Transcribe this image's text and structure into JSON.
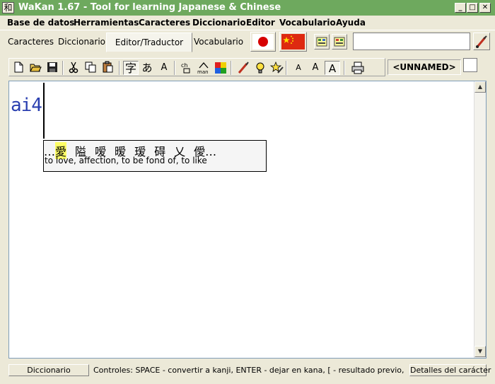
{
  "window": {
    "app_icon_glyph": "和",
    "title": "WaKan 1.67 - Tool for learning Japanese & Chinese",
    "minimize_glyph": "_",
    "maximize_glyph": "□",
    "close_glyph": "✕"
  },
  "menu": [
    {
      "label": "Base de datos"
    },
    {
      "label": "Herramientas"
    },
    {
      "label": "Caracteres"
    },
    {
      "label": "Diccionario"
    },
    {
      "label": "Editor"
    },
    {
      "label": "Vocabulario"
    },
    {
      "label": "Ayuda"
    }
  ],
  "tabs": {
    "caracteres": "Caracteres",
    "diccionario": "Diccionario",
    "editor": "Editor/Traductor",
    "vocabulario": "Vocabulario"
  },
  "toolbar": {
    "kanji_mode": "字",
    "kana_mode": "あ",
    "romaji_mode": "A",
    "font_small": "A",
    "font_medium": "A",
    "font_large": "A",
    "document_name": "<UNNAMED>"
  },
  "editor": {
    "typed_text": "ai4"
  },
  "popup": {
    "leading": "…",
    "candidates": [
      "愛",
      "隘",
      "嗳",
      "暧",
      "瑷",
      "碍",
      "乂",
      "僾"
    ],
    "trailing": "…",
    "meaning": "to love, affection, to be fond of, to like"
  },
  "status": {
    "dict_button": "Diccionario",
    "hint": "Controles: SPACE - convertir a kanji, ENTER - dejar en kana, [ - resultado previo, ] - próximo resultado",
    "details_button": "Detalles del carácter"
  },
  "colors": {
    "titlebar": "#6ea95e",
    "typed_text": "#2a3fb0",
    "candidate_highlight": "#ffff66"
  }
}
